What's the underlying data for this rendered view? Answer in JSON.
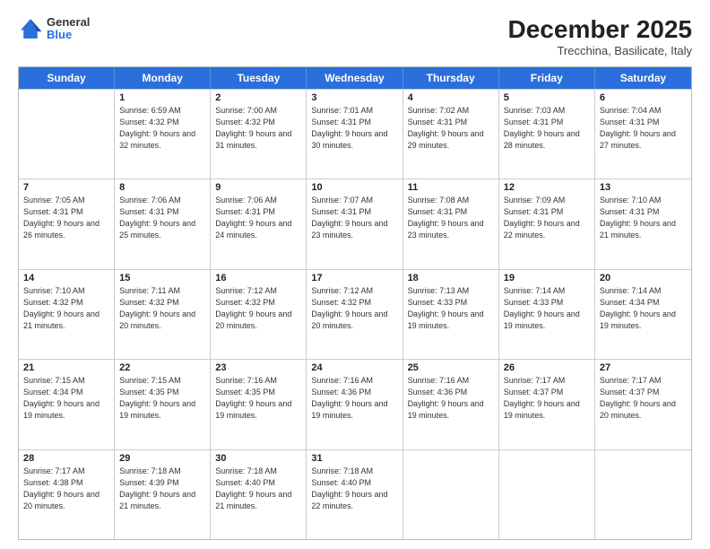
{
  "header": {
    "logo_general": "General",
    "logo_blue": "Blue",
    "month_title": "December 2025",
    "location": "Trecchina, Basilicate, Italy"
  },
  "weekdays": [
    "Sunday",
    "Monday",
    "Tuesday",
    "Wednesday",
    "Thursday",
    "Friday",
    "Saturday"
  ],
  "weeks": [
    [
      {
        "day": "",
        "sunrise": "",
        "sunset": "",
        "daylight": ""
      },
      {
        "day": "1",
        "sunrise": "6:59 AM",
        "sunset": "4:32 PM",
        "daylight": "9 hours and 32 minutes."
      },
      {
        "day": "2",
        "sunrise": "7:00 AM",
        "sunset": "4:32 PM",
        "daylight": "9 hours and 31 minutes."
      },
      {
        "day": "3",
        "sunrise": "7:01 AM",
        "sunset": "4:31 PM",
        "daylight": "9 hours and 30 minutes."
      },
      {
        "day": "4",
        "sunrise": "7:02 AM",
        "sunset": "4:31 PM",
        "daylight": "9 hours and 29 minutes."
      },
      {
        "day": "5",
        "sunrise": "7:03 AM",
        "sunset": "4:31 PM",
        "daylight": "9 hours and 28 minutes."
      },
      {
        "day": "6",
        "sunrise": "7:04 AM",
        "sunset": "4:31 PM",
        "daylight": "9 hours and 27 minutes."
      }
    ],
    [
      {
        "day": "7",
        "sunrise": "7:05 AM",
        "sunset": "4:31 PM",
        "daylight": "9 hours and 26 minutes."
      },
      {
        "day": "8",
        "sunrise": "7:06 AM",
        "sunset": "4:31 PM",
        "daylight": "9 hours and 25 minutes."
      },
      {
        "day": "9",
        "sunrise": "7:06 AM",
        "sunset": "4:31 PM",
        "daylight": "9 hours and 24 minutes."
      },
      {
        "day": "10",
        "sunrise": "7:07 AM",
        "sunset": "4:31 PM",
        "daylight": "9 hours and 23 minutes."
      },
      {
        "day": "11",
        "sunrise": "7:08 AM",
        "sunset": "4:31 PM",
        "daylight": "9 hours and 23 minutes."
      },
      {
        "day": "12",
        "sunrise": "7:09 AM",
        "sunset": "4:31 PM",
        "daylight": "9 hours and 22 minutes."
      },
      {
        "day": "13",
        "sunrise": "7:10 AM",
        "sunset": "4:31 PM",
        "daylight": "9 hours and 21 minutes."
      }
    ],
    [
      {
        "day": "14",
        "sunrise": "7:10 AM",
        "sunset": "4:32 PM",
        "daylight": "9 hours and 21 minutes."
      },
      {
        "day": "15",
        "sunrise": "7:11 AM",
        "sunset": "4:32 PM",
        "daylight": "9 hours and 20 minutes."
      },
      {
        "day": "16",
        "sunrise": "7:12 AM",
        "sunset": "4:32 PM",
        "daylight": "9 hours and 20 minutes."
      },
      {
        "day": "17",
        "sunrise": "7:12 AM",
        "sunset": "4:32 PM",
        "daylight": "9 hours and 20 minutes."
      },
      {
        "day": "18",
        "sunrise": "7:13 AM",
        "sunset": "4:33 PM",
        "daylight": "9 hours and 19 minutes."
      },
      {
        "day": "19",
        "sunrise": "7:14 AM",
        "sunset": "4:33 PM",
        "daylight": "9 hours and 19 minutes."
      },
      {
        "day": "20",
        "sunrise": "7:14 AM",
        "sunset": "4:34 PM",
        "daylight": "9 hours and 19 minutes."
      }
    ],
    [
      {
        "day": "21",
        "sunrise": "7:15 AM",
        "sunset": "4:34 PM",
        "daylight": "9 hours and 19 minutes."
      },
      {
        "day": "22",
        "sunrise": "7:15 AM",
        "sunset": "4:35 PM",
        "daylight": "9 hours and 19 minutes."
      },
      {
        "day": "23",
        "sunrise": "7:16 AM",
        "sunset": "4:35 PM",
        "daylight": "9 hours and 19 minutes."
      },
      {
        "day": "24",
        "sunrise": "7:16 AM",
        "sunset": "4:36 PM",
        "daylight": "9 hours and 19 minutes."
      },
      {
        "day": "25",
        "sunrise": "7:16 AM",
        "sunset": "4:36 PM",
        "daylight": "9 hours and 19 minutes."
      },
      {
        "day": "26",
        "sunrise": "7:17 AM",
        "sunset": "4:37 PM",
        "daylight": "9 hours and 19 minutes."
      },
      {
        "day": "27",
        "sunrise": "7:17 AM",
        "sunset": "4:37 PM",
        "daylight": "9 hours and 20 minutes."
      }
    ],
    [
      {
        "day": "28",
        "sunrise": "7:17 AM",
        "sunset": "4:38 PM",
        "daylight": "9 hours and 20 minutes."
      },
      {
        "day": "29",
        "sunrise": "7:18 AM",
        "sunset": "4:39 PM",
        "daylight": "9 hours and 21 minutes."
      },
      {
        "day": "30",
        "sunrise": "7:18 AM",
        "sunset": "4:40 PM",
        "daylight": "9 hours and 21 minutes."
      },
      {
        "day": "31",
        "sunrise": "7:18 AM",
        "sunset": "4:40 PM",
        "daylight": "9 hours and 22 minutes."
      },
      {
        "day": "",
        "sunrise": "",
        "sunset": "",
        "daylight": ""
      },
      {
        "day": "",
        "sunrise": "",
        "sunset": "",
        "daylight": ""
      },
      {
        "day": "",
        "sunrise": "",
        "sunset": "",
        "daylight": ""
      }
    ]
  ]
}
